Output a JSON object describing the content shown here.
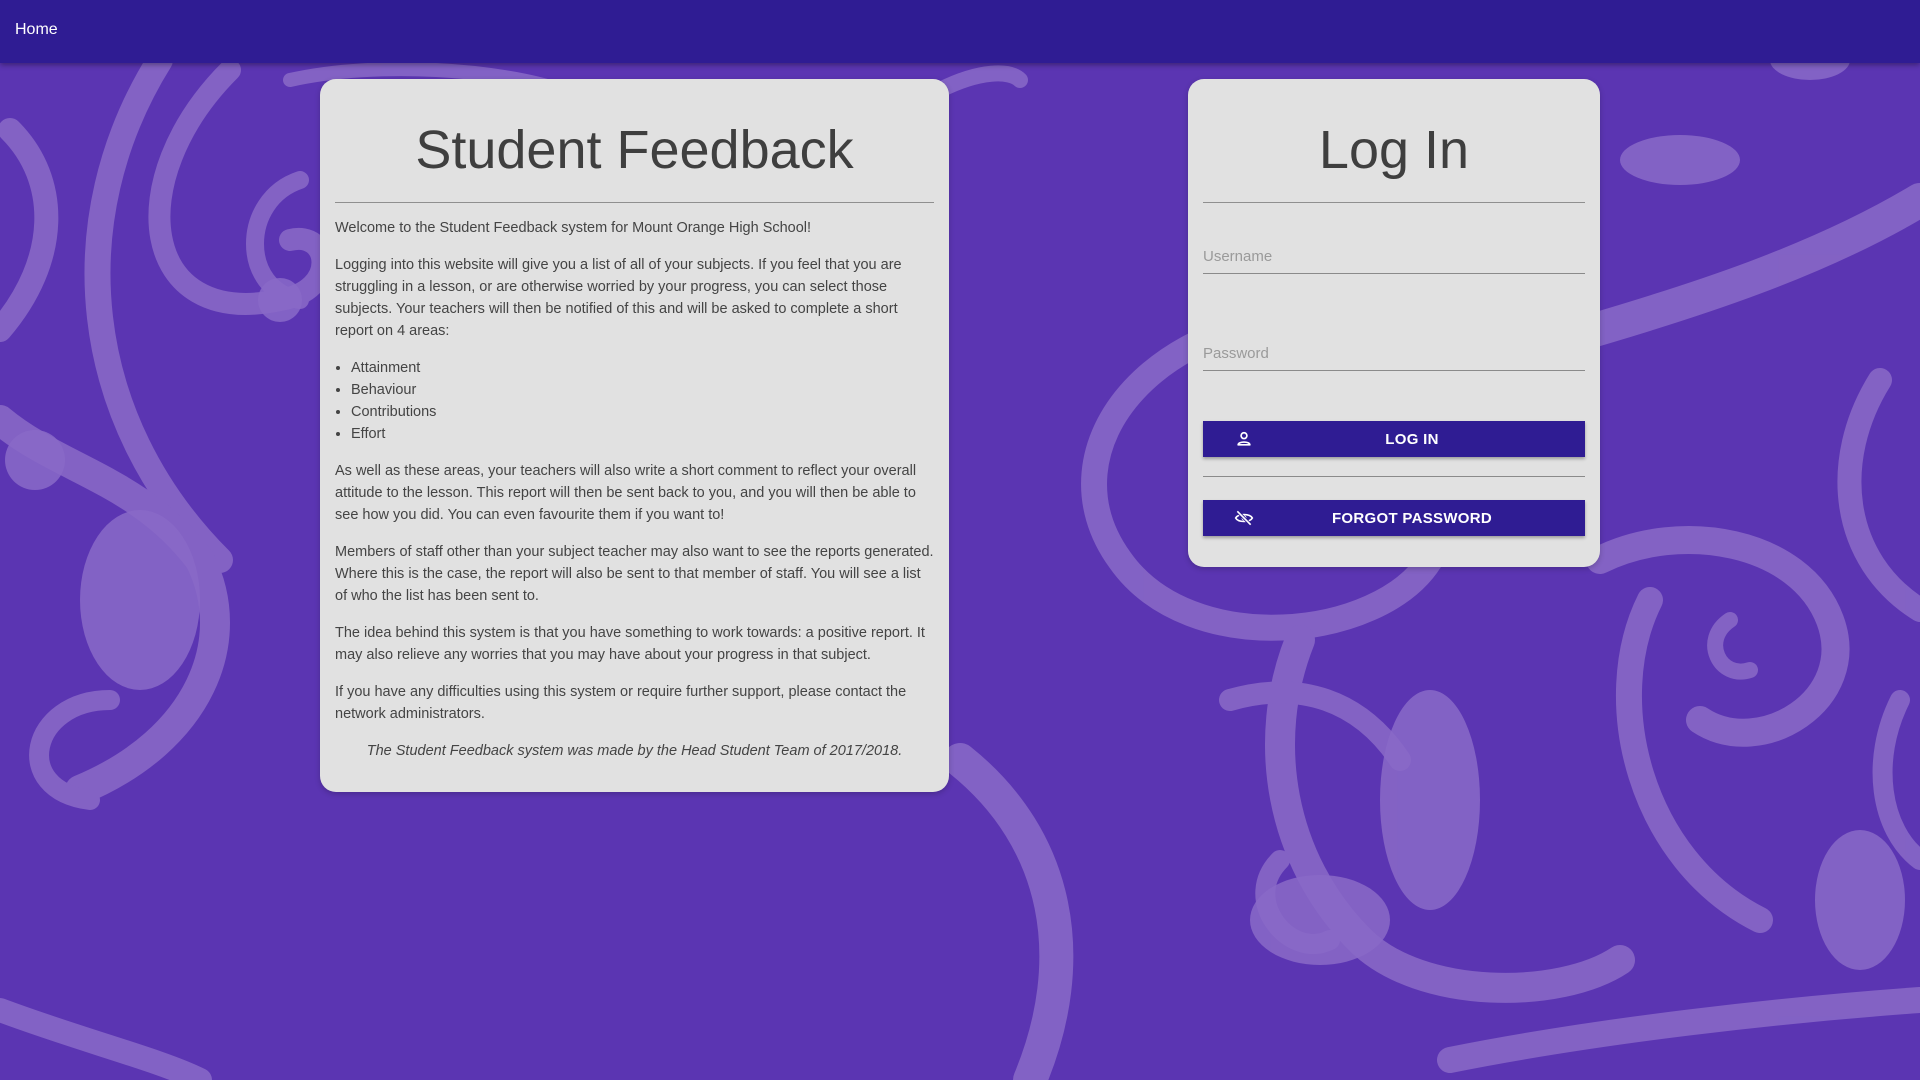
{
  "nav": {
    "home_label": "Home"
  },
  "info": {
    "title": "Student Feedback",
    "paragraphs": {
      "welcome": "Welcome to the Student Feedback system for Mount Orange High School!",
      "intro": "Logging into this website will give you a list of all of your subjects. If you feel that you are struggling in a lesson, or are otherwise worried by your progress, you can select those subjects. Your teachers will then be notified of this and will be asked to complete a short report on 4 areas:",
      "comment": "As well as these areas, your teachers will also write a short comment to reflect your overall attitude to the lesson. This report will then be sent back to you, and you will then be able to see how you did. You can even favourite them if you want to!",
      "staff": "Members of staff other than your subject teacher may also want to see the reports generated. Where this is the case, the report will also be sent to that member of staff. You will see a list of who the list has been sent to.",
      "idea": "The idea behind this system is that you have something to work towards: a positive report. It may also relieve any worries that you may have about your progress in that subject.",
      "support": "If you have any difficulties using this system or require further support, please contact the network administrators.",
      "credit": "The Student Feedback system was made by the Head Student Team of 2017/2018."
    },
    "areas": [
      "Attainment",
      "Behaviour",
      "Contributions",
      "Effort"
    ]
  },
  "login": {
    "title": "Log In",
    "username_placeholder": "Username",
    "password_placeholder": "Password",
    "login_button": "LOG IN",
    "forgot_button": "FORGOT PASSWORD",
    "login_icon": "person-icon",
    "forgot_icon": "eye-off-icon"
  },
  "colors": {
    "topbar": "#2f1c93",
    "background": "#5b35b2",
    "decoration": "#8a6ac8",
    "card": "#e1e1e1",
    "button": "#2f1c93"
  }
}
